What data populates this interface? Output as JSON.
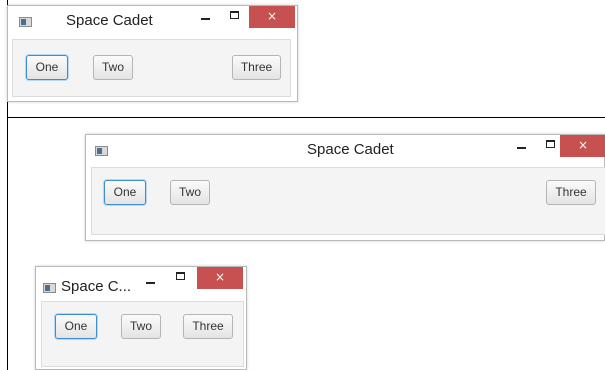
{
  "windows": [
    {
      "title": "Space Cadet",
      "controls": {
        "minimize": "minimize",
        "maximize": "maximize",
        "close": "×"
      },
      "buttons": [
        {
          "label": "One",
          "focused": true
        },
        {
          "label": "Two"
        },
        {
          "label": "Three"
        }
      ]
    },
    {
      "title": "Space Cadet",
      "controls": {
        "minimize": "minimize",
        "maximize": "maximize",
        "close": "×"
      },
      "buttons": [
        {
          "label": "One",
          "focused": true
        },
        {
          "label": "Two"
        },
        {
          "label": "Three"
        }
      ]
    },
    {
      "title": "Space C...",
      "controls": {
        "minimize": "minimize",
        "maximize": "maximize",
        "close": "×"
      },
      "buttons": [
        {
          "label": "One",
          "focused": true
        },
        {
          "label": "Two"
        },
        {
          "label": "Three"
        }
      ]
    }
  ],
  "colors": {
    "close": "#c75050",
    "focus": "#3a8fd1",
    "pane": "#f4f4f4"
  }
}
